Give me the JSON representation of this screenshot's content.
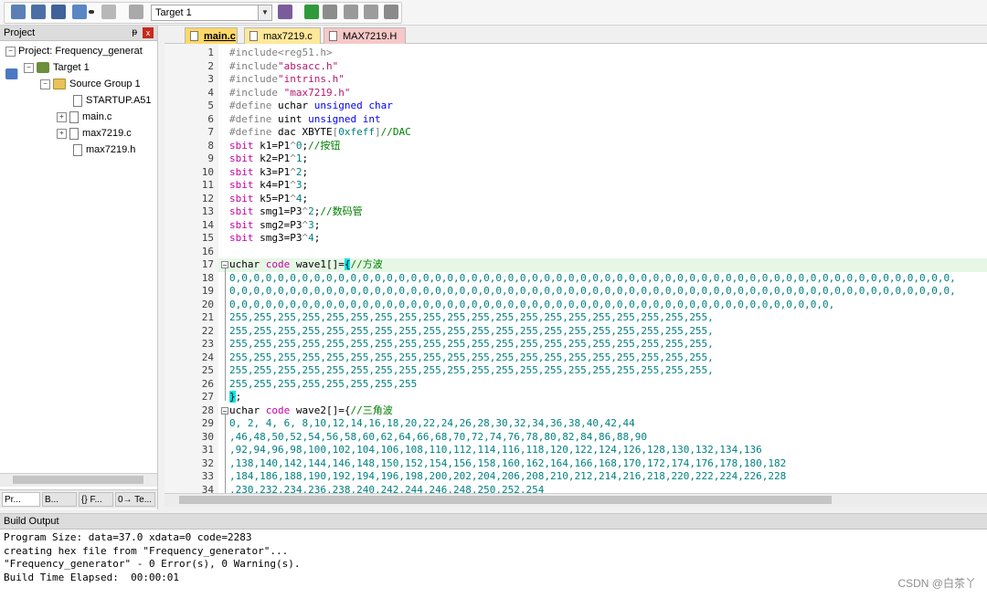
{
  "toolbar": {
    "target_select": "Target 1",
    "icons": [
      "translate-icon",
      "build-icon",
      "rebuild-icon",
      "batch-build-icon",
      "stop-build-icon",
      "download-icon",
      "target-options-icon",
      "manage-components-icon",
      "pack-installer-icon",
      "select-packs-icon",
      "manage-runtime-icon",
      "event-recorder-icon"
    ]
  },
  "project": {
    "title": "Project",
    "pin": "ᵽ",
    "close": "x",
    "tree": {
      "root": "Project: Frequency_generat",
      "target": "Target 1",
      "group": "Source Group 1",
      "files": [
        "STARTUP.A51",
        "main.c",
        "max7219.c",
        "max7219.h"
      ]
    },
    "bottom_tabs": [
      "Pr...",
      "B...",
      "{} F...",
      "0→ Te..."
    ]
  },
  "editor": {
    "tabs": [
      "main.c",
      "max7219.c",
      "MAX7219.H"
    ],
    "lines": [
      [
        [
          "pp",
          "#include<reg51.h>"
        ]
      ],
      [
        [
          "pp",
          "#include"
        ],
        [
          "str",
          "\"absacc.h\""
        ]
      ],
      [
        [
          "pp",
          "#include"
        ],
        [
          "str",
          "\"intrins.h\""
        ]
      ],
      [
        [
          "pp",
          "#include "
        ],
        [
          "str",
          "\"max7219.h\""
        ]
      ],
      [
        [
          "pp",
          "#define "
        ],
        [
          "t",
          "uchar "
        ],
        [
          "kw",
          "unsigned char"
        ]
      ],
      [
        [
          "pp",
          "#define "
        ],
        [
          "t",
          "uint "
        ],
        [
          "kw",
          "unsigned int"
        ]
      ],
      [
        [
          "pp",
          "#define "
        ],
        [
          "t",
          "dac XBYTE"
        ],
        [
          "pp",
          "["
        ],
        [
          "num",
          "0xfeff"
        ],
        [
          "pp",
          "]"
        ],
        [
          "cm",
          "//DAC"
        ]
      ],
      [
        [
          "kwr",
          "sbit "
        ],
        [
          "t",
          "k1=P1"
        ],
        [
          "pp",
          "^"
        ],
        [
          "num",
          "0"
        ],
        [
          "t",
          ";"
        ],
        [
          "cm",
          "//按钮"
        ]
      ],
      [
        [
          "kwr",
          "sbit "
        ],
        [
          "t",
          "k2=P1"
        ],
        [
          "pp",
          "^"
        ],
        [
          "num",
          "1"
        ],
        [
          "t",
          ";"
        ]
      ],
      [
        [
          "kwr",
          "sbit "
        ],
        [
          "t",
          "k3=P1"
        ],
        [
          "pp",
          "^"
        ],
        [
          "num",
          "2"
        ],
        [
          "t",
          ";"
        ]
      ],
      [
        [
          "kwr",
          "sbit "
        ],
        [
          "t",
          "k4=P1"
        ],
        [
          "pp",
          "^"
        ],
        [
          "num",
          "3"
        ],
        [
          "t",
          ";"
        ]
      ],
      [
        [
          "kwr",
          "sbit "
        ],
        [
          "t",
          "k5=P1"
        ],
        [
          "pp",
          "^"
        ],
        [
          "num",
          "4"
        ],
        [
          "t",
          ";"
        ]
      ],
      [
        [
          "kwr",
          "sbit "
        ],
        [
          "t",
          "smg1=P3"
        ],
        [
          "pp",
          "^"
        ],
        [
          "num",
          "2"
        ],
        [
          "t",
          ";"
        ],
        [
          "cm",
          "//数码管"
        ]
      ],
      [
        [
          "kwr",
          "sbit "
        ],
        [
          "t",
          "smg2=P3"
        ],
        [
          "pp",
          "^"
        ],
        [
          "num",
          "3"
        ],
        [
          "t",
          ";"
        ]
      ],
      [
        [
          "kwr",
          "sbit "
        ],
        [
          "t",
          "smg3=P3"
        ],
        [
          "pp",
          "^"
        ],
        [
          "num",
          "4"
        ],
        [
          "t",
          ";"
        ]
      ],
      [],
      [
        [
          "t",
          "uchar "
        ],
        [
          "kwr",
          "code "
        ],
        [
          "t",
          "wave1[]="
        ],
        [
          "brk",
          "{"
        ],
        [
          "cm",
          "//方波"
        ]
      ],
      [
        [
          "num",
          "0,0,0,0,0,0,0,0,0,0,0,0,0,0,0,0,0,0,0,0,0,0,0,0,0,0,0,0,0,0,0,0,0,0,0,0,0,0,0,0,0,0,0,0,0,0,0,0,0,0,0,0,0,0,0,0,0,0,0,0,"
        ]
      ],
      [
        [
          "num",
          "0,0,0,0,0,0,0,0,0,0,0,0,0,0,0,0,0,0,0,0,0,0,0,0,0,0,0,0,0,0,0,0,0,0,0,0,0,0,0,0,0,0,0,0,0,0,0,0,0,0,0,0,0,0,0,0,0,0,0,0,"
        ]
      ],
      [
        [
          "num",
          "0,0,0,0,0,0,0,0,0,0,0,0,0,0,0,0,0,0,0,0,0,0,0,0,0,0,0,0,0,0,0,0,0,0,0,0,0,0,0,0,0,0,0,0,0,0,0,0,0,0,"
        ]
      ],
      [
        [
          "num",
          "255,255,255,255,255,255,255,255,255,255,255,255,255,255,255,255,255,255,255,255,"
        ]
      ],
      [
        [
          "num",
          "255,255,255,255,255,255,255,255,255,255,255,255,255,255,255,255,255,255,255,255,"
        ]
      ],
      [
        [
          "num",
          "255,255,255,255,255,255,255,255,255,255,255,255,255,255,255,255,255,255,255,255,"
        ]
      ],
      [
        [
          "num",
          "255,255,255,255,255,255,255,255,255,255,255,255,255,255,255,255,255,255,255,255,"
        ]
      ],
      [
        [
          "num",
          "255,255,255,255,255,255,255,255,255,255,255,255,255,255,255,255,255,255,255,255,"
        ]
      ],
      [
        [
          "num",
          "255,255,255,255,255,255,255,255"
        ]
      ],
      [
        [
          "brk",
          "}"
        ],
        [
          "t",
          ";"
        ]
      ],
      [
        [
          "t",
          "uchar "
        ],
        [
          "kwr",
          "code "
        ],
        [
          "t",
          "wave2[]={"
        ],
        [
          "cm",
          "//三角波"
        ]
      ],
      [
        [
          "num",
          "0, 2, 4, 6, 8,10,12,14,16,18,20,22,24,26,28,30,32,34,36,38,40,42,44"
        ]
      ],
      [
        [
          "num",
          ",46,48,50,52,54,56,58,60,62,64,66,68,70,72,74,76,78,80,82,84,86,88,90"
        ]
      ],
      [
        [
          "num",
          ",92,94,96,98,100,102,104,106,108,110,112,114,116,118,120,122,124,126,128,130,132,134,136"
        ]
      ],
      [
        [
          "num",
          ",138,140,142,144,146,148,150,152,154,156,158,160,162,164,166,168,170,172,174,176,178,180,182"
        ]
      ],
      [
        [
          "num",
          ",184,186,188,190,192,194,196,198,200,202,204,206,208,210,212,214,216,218,220,222,224,226,228"
        ]
      ],
      [
        [
          "num",
          ",230,232,234,236,238,240,242,244,246,248,250,252,254"
        ]
      ]
    ]
  },
  "build_output": {
    "title": "Build Output",
    "lines": [
      "Program Size: data=37.0 xdata=0 code=2283",
      "creating hex file from \"Frequency_generator\"...",
      "\"Frequency_generator\" - 0 Error(s), 0 Warning(s).",
      "Build Time Elapsed:  00:00:01"
    ]
  },
  "watermark": "CSDN @白茶丫"
}
